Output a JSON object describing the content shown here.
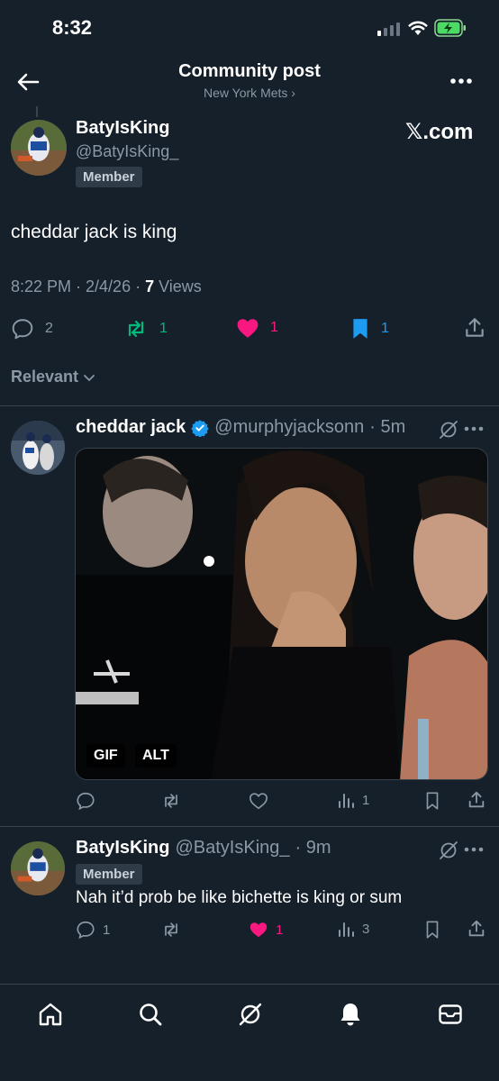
{
  "status_bar": {
    "time": "8:32"
  },
  "header": {
    "title": "Community post",
    "community": "New York Mets ›"
  },
  "post": {
    "author_name": "BatyIsKing",
    "author_handle": "@BatyIsKing_",
    "badge": "Member",
    "watermark": "𝕏.com",
    "text": "cheddar jack is king",
    "time": "8:22 PM · 2/4/26 · ",
    "views_count": "7",
    "views_label": " Views",
    "replies": "2",
    "reposts": "1",
    "likes": "1",
    "bookmarks": "1"
  },
  "sort": {
    "label": "Relevant"
  },
  "replies": [
    {
      "author_name": "cheddar jack",
      "author_handle": "@murphyjacksonn",
      "time": "· 5m",
      "media_tags": [
        "GIF",
        "ALT"
      ],
      "views": "1"
    },
    {
      "author_name": "BatyIsKing",
      "author_handle": "@BatyIsKing_",
      "time": "· 9m",
      "badge": "Member",
      "text": "Nah it’d prob be like bichette is king or sum",
      "replies": "1",
      "likes": "1",
      "views": "3"
    }
  ],
  "icons": [
    "back-arrow-icon",
    "more-icon",
    "reply-icon",
    "repost-icon",
    "heart-icon",
    "bookmark-icon",
    "share-icon",
    "grok-icon",
    "verified-icon",
    "views-icon",
    "home-icon",
    "search-icon",
    "notifications-icon",
    "messages-icon"
  ],
  "colors": {
    "background": "#15202b",
    "repost": "#00ba7c",
    "like": "#f91880",
    "bookmark": "#1d9bf0",
    "verified": "#1d9bf0",
    "muted": "#8b98a5"
  }
}
